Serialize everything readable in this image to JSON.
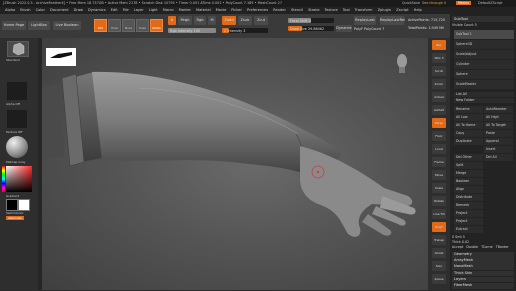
{
  "titlebar": {
    "text": "[ZBrush 2022.0.5 - ArchiveFeather4]  • Free Mem 18.737GB • Active Mem 2178 • Scratch Disk 10795 • Timer 0.001 ATime 0.002 • PolyCount 7.189 • MeshCount 27",
    "quicksave": "QuickSave",
    "seethrough": "See-through 0",
    "menus": "Menus",
    "default_script": "DefaultZScript"
  },
  "menubar": [
    "Alpha",
    "Brush",
    "Color",
    "Document",
    "Draw",
    "Dynamics",
    "Edit",
    "File",
    "Layer",
    "Light",
    "Macro",
    "Marker",
    "Material",
    "Movie",
    "Picker",
    "Preferences",
    "Render",
    "Stencil",
    "Stroke",
    "Texture",
    "Tool",
    "Transform",
    "Zplugin",
    "Zscript",
    "Help"
  ],
  "toolbar": {
    "home_page": "Home Page",
    "lightbox": "LightBox",
    "live_boolean": "Live Boolean",
    "edit": "Edit",
    "draw": "Draw",
    "move": "Move",
    "scale": "Scale",
    "rotate": "Rotate",
    "a_label": "A",
    "mrgb": "Mrgb",
    "rgb": "Rgb",
    "m": "M",
    "zadd": "Zadd",
    "zsub": "Zsub",
    "zcut": "Zcut",
    "focal_shift": "Focal Shift 0",
    "draw_size": "Draw Size 29.86462",
    "dynamic": "Dynamic",
    "rgb_intensity": "Rgb Intensity 100",
    "z_intensity": "Z Intensity 3",
    "replay_last": "ReplayLast",
    "replay_last_rel": "ReplayLastRel",
    "active_points": "ActivePoints: 715,720",
    "total_points": "TotalPoints: 1.949 Mil",
    "polyf": "PolyF",
    "polycount": "PolyCount 7"
  },
  "left": {
    "brush": "Standard",
    "alpha": "Alpha Off",
    "texture": "Texture Off",
    "material": "MatCap Gray",
    "gradient": "Gradient",
    "switch_color": "SwitchColor",
    "alternate": "Alternate"
  },
  "right_shelf": [
    "Bpr",
    "SPix 3",
    "Scroll",
    "Zoom",
    "Actual",
    "AAHalf",
    "Persp",
    "Floor",
    "Local",
    "Frame",
    "Move",
    "Scale",
    "Rotate",
    "Line Fill",
    "PolyF",
    "Transp",
    "Ghost",
    "Solo",
    "Xpose"
  ],
  "tray": {
    "subtool_header": "SubTool",
    "visible_count": "Visible Count 5",
    "subtools": [
      "SubTool 1",
      "Sphere3D",
      "Scale/Adjust",
      "Cylinder",
      "Sphere",
      "ScaleMaster"
    ],
    "list_all": "List All",
    "new_folder": "New Folder",
    "rows": [
      [
        "Rename",
        "AutoReorder"
      ],
      [
        "All Low",
        "All High"
      ],
      [
        "All To Home",
        "All To Target"
      ],
      [
        "Copy",
        "Paste"
      ],
      [
        "Duplicate",
        "Append"
      ],
      [
        "",
        "Insert"
      ],
      [
        "Del Other",
        "Del All"
      ],
      [
        "Split",
        ""
      ],
      [
        "Merge",
        ""
      ],
      [
        "Boolean",
        ""
      ],
      [
        "Align",
        ""
      ],
      [
        "Distribute",
        ""
      ],
      [
        "Remesh",
        ""
      ],
      [
        "Project",
        ""
      ],
      [
        "Project BasRelief",
        ""
      ],
      [
        "Extract",
        ""
      ]
    ],
    "extract": {
      "s_smt": "S Smt 5",
      "thick": "Thick 0.02",
      "accept": "Accept",
      "double": "Double",
      "tcorner": "TCorne",
      "tborder": "TBorder"
    },
    "sections": [
      "Geometry",
      "ArrayMesh",
      "NanoMesh",
      "Thick Skin",
      "Layers",
      "FiberMesh"
    ]
  }
}
